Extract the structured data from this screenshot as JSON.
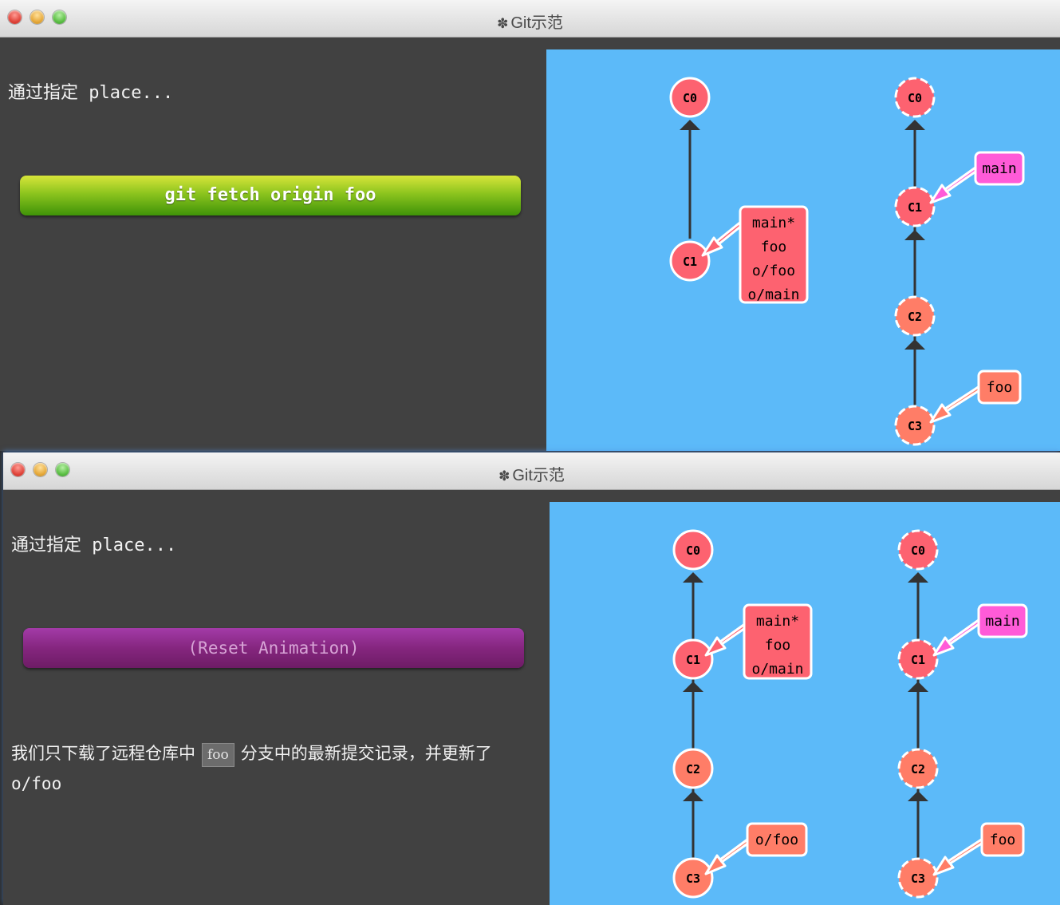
{
  "window_title": "Git示范",
  "top": {
    "intro": "通过指定 place...",
    "command_button": "git fetch origin foo",
    "local": {
      "commits": [
        "C0",
        "C1"
      ],
      "label": [
        "main*",
        "foo",
        "o/foo",
        "o/main"
      ]
    },
    "remote": {
      "commits": [
        "C0",
        "C1",
        "C2",
        "C3"
      ],
      "main_label": "main",
      "foo_label": "foo"
    }
  },
  "bottom": {
    "intro": "通过指定 place...",
    "reset_button": "(Reset Animation)",
    "desc_before": "我们只下载了远程仓库中",
    "desc_code": "foo",
    "desc_after": "分支中的最新提交记录，并更新了 o/foo",
    "local": {
      "commits": [
        "C0",
        "C1",
        "C2",
        "C3"
      ],
      "label": [
        "main*",
        "foo",
        "o/main"
      ],
      "ofoo_label": "o/foo"
    },
    "remote": {
      "commits": [
        "C0",
        "C1",
        "C2",
        "C3"
      ],
      "main_label": "main",
      "foo_label": "foo"
    }
  },
  "colors": {
    "canvas": "#5cbaf9",
    "commit": "#fd6270",
    "remote_commit_tail": "#ff7d67",
    "main_branch": "#ff5bd8",
    "foo_branch": "#ff7d67"
  }
}
